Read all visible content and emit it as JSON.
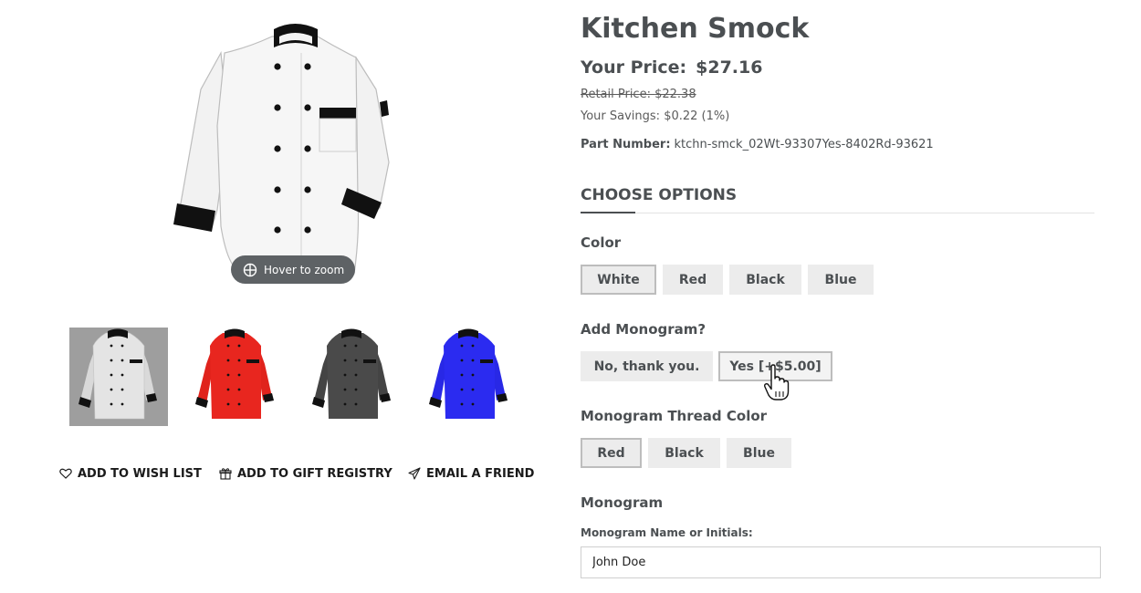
{
  "product": {
    "title": "Kitchen Smock",
    "price_label": "Your Price:",
    "price_value": "$27.16",
    "retail_label": "Retail Price:",
    "retail_value": "$22.38",
    "savings_label": "Your Savings:",
    "savings_value": "$0.22 (1%)",
    "part_label": "Part Number:",
    "part_value": "ktchn-smck_02Wt-93307Yes-8402Rd-93621"
  },
  "gallery": {
    "zoom_hint": "Hover to zoom",
    "zoom_icon": "crosshair-icon",
    "thumbnails": [
      {
        "color_name": "white",
        "fill": "#e4e4e4",
        "trim": "#111111",
        "selected": true
      },
      {
        "color_name": "red",
        "fill": "#e8261f",
        "trim": "#111111",
        "selected": false
      },
      {
        "color_name": "black",
        "fill": "#4a4a4a",
        "trim": "#111111",
        "selected": false
      },
      {
        "color_name": "blue",
        "fill": "#2b2bf0",
        "trim": "#111111",
        "selected": false
      }
    ],
    "main_fill": "#f4f4f4",
    "main_trim": "#111111"
  },
  "actions": {
    "wish_list": "ADD TO WISH LIST",
    "gift_registry": "ADD TO GIFT REGISTRY",
    "email_friend": "EMAIL A FRIEND",
    "wish_icon": "heart-icon",
    "gift_icon": "gift-icon",
    "email_icon": "paper-plane-icon"
  },
  "options": {
    "heading": "CHOOSE OPTIONS",
    "color": {
      "label": "Color",
      "values": [
        "White",
        "Red",
        "Black",
        "Blue"
      ],
      "selected": "White"
    },
    "monogram_choice": {
      "label": "Add Monogram?",
      "values": [
        "No, thank you.",
        "Yes [+$5.00]"
      ],
      "hovered": "Yes [+$5.00]"
    },
    "thread_color": {
      "label": "Monogram Thread Color",
      "values": [
        "Red",
        "Black",
        "Blue"
      ],
      "selected": "Red"
    },
    "monogram": {
      "label": "Monogram",
      "field_label": "Monogram Name or Initials:",
      "field_value": "John Doe"
    }
  },
  "colors": {
    "text": "#4b4f52",
    "option_bg": "#ececec",
    "option_selected_border": "#bdbdbd",
    "pill_bg": "#5e6265"
  }
}
